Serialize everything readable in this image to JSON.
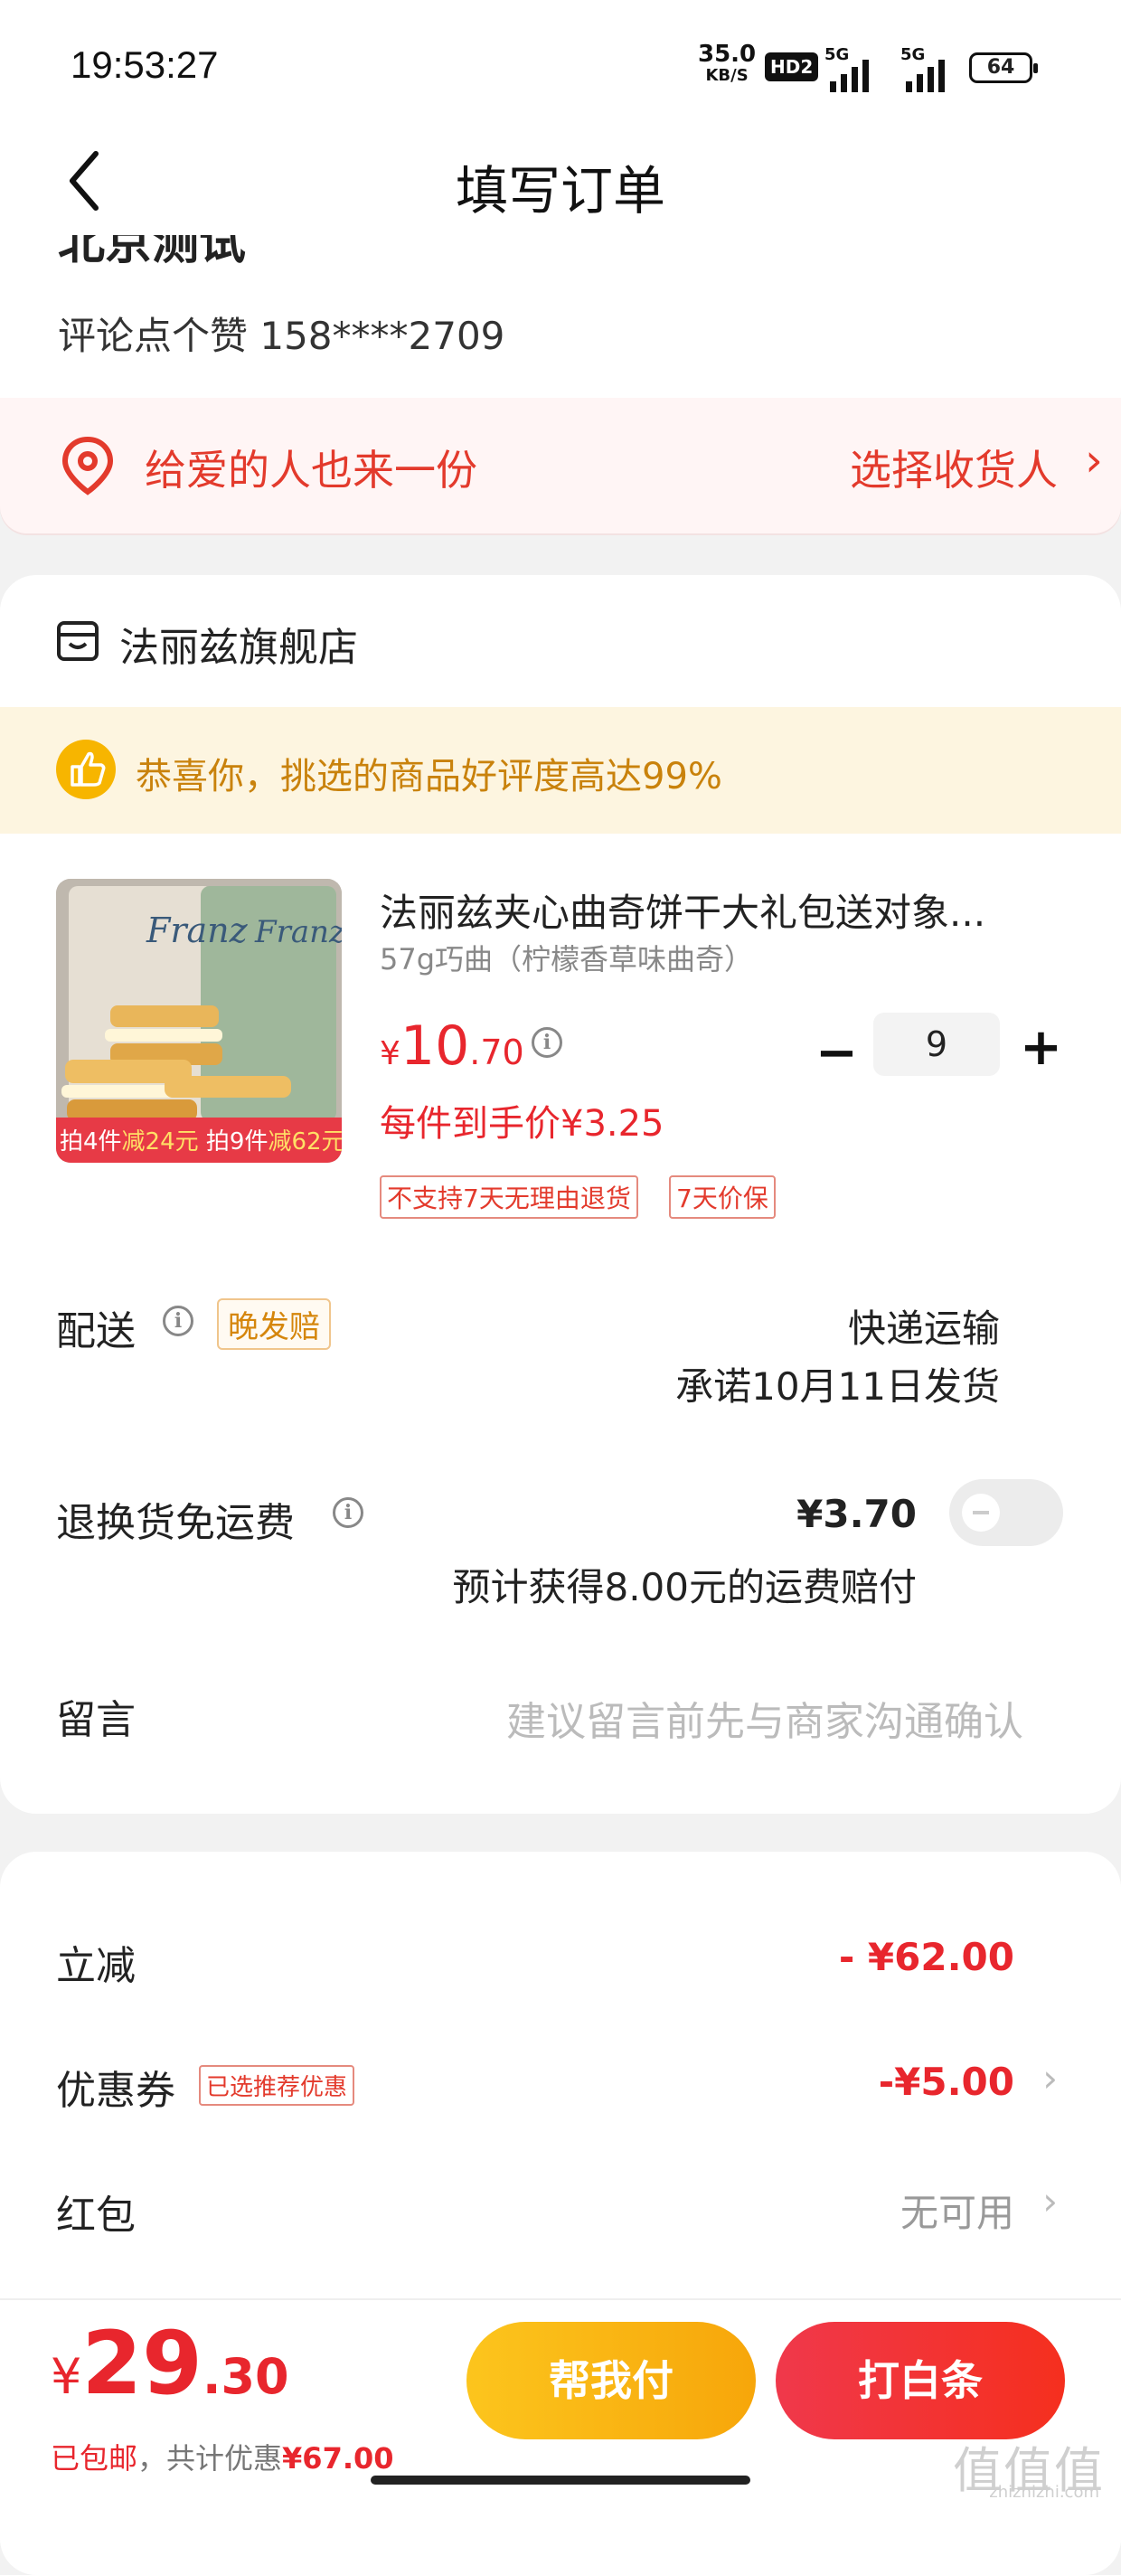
{
  "status_bar": {
    "time": "19:53:27",
    "net_speed": "35.0",
    "net_unit": "KB/S",
    "hd_label": "HD2",
    "signal1": "5G",
    "signal2": "5G",
    "battery": "64"
  },
  "header": {
    "title": "填写订单"
  },
  "address": {
    "name_partial": "北京测试",
    "contact": "评论点个赞  158****2709"
  },
  "gift_banner": {
    "text": "给爱的人也来一份",
    "action": "选择收货人",
    "chevron": "›"
  },
  "store": {
    "name": "法丽兹旗舰店",
    "praise": "恭喜你，挑选的商品好评度高达99%"
  },
  "product": {
    "title": "法丽兹夹心曲奇饼干大礼包送对象...",
    "spec": "57g巧曲（柠檬香草味曲奇）",
    "price_currency": "¥",
    "price_int": "10",
    "price_dec": ".70",
    "unit_price": "每件到手价¥3.25",
    "quantity": "9",
    "minus": "−",
    "plus": "+",
    "image_promo": {
      "p1a": "拍4件",
      "p1b": "减24元",
      "p2a": "拍9件",
      "p2b": "减62元",
      "brand": "Franz"
    },
    "tags": [
      "不支持7天无理由退货",
      "7天价保"
    ]
  },
  "delivery": {
    "label": "配送",
    "badge": "晚发赔",
    "method": "快递运输",
    "promise": "承诺10月11日发货"
  },
  "return_shipping": {
    "label": "退换货免运费",
    "price": "¥3.70",
    "note": "预计获得8.00元的运费赔付",
    "enabled": false
  },
  "message": {
    "label": "留言",
    "placeholder": "建议留言前先与商家沟通确认"
  },
  "discounts": {
    "instant_label": "立减",
    "instant_value": "- ¥62.00",
    "coupon_label": "优惠券",
    "coupon_badge": "已选推荐优惠",
    "coupon_value": "-¥5.00",
    "redpacket_label": "红包",
    "redpacket_value": "无可用",
    "chevron": "›"
  },
  "bottom_bar": {
    "currency": "¥",
    "total_int": "29",
    "total_dec": ".30",
    "free_shipping": "已包邮",
    "saved_prefix": "，共计优惠",
    "saved_amount": "¥67.00",
    "pay_for_me": "帮我付",
    "credit_pay": "打白条"
  },
  "watermark": {
    "main": "值值值",
    "sub": "zhizhizhi.com"
  },
  "colors": {
    "accent_red": "#e8262d",
    "gold": "#f7b500",
    "praise_bg": "#fdf5e0"
  }
}
